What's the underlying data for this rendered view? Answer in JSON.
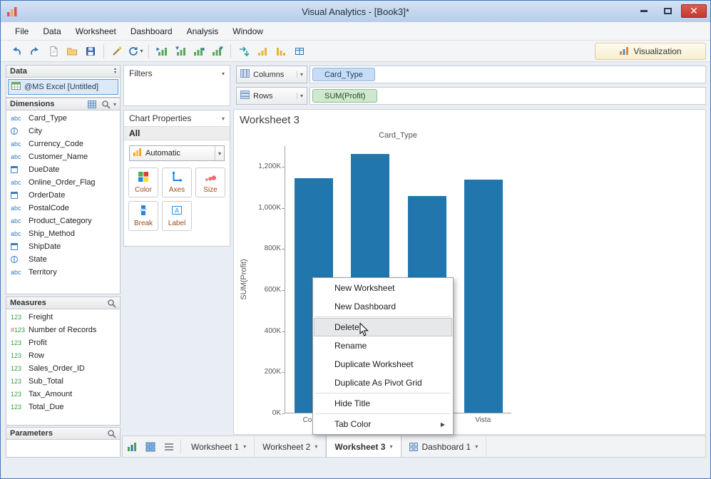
{
  "titlebar": {
    "title": "Visual Analytics - [Book3]*"
  },
  "menu": {
    "items": [
      "File",
      "Data",
      "Worksheet",
      "Dashboard",
      "Analysis",
      "Window"
    ]
  },
  "toolbar": {
    "visualization_label": "Visualization"
  },
  "data_panel": {
    "title": "Data",
    "datasource": "@MS Excel [Untitled]",
    "dimensions": {
      "title": "Dimensions",
      "items": [
        {
          "icon": "abc",
          "label": "Card_Type"
        },
        {
          "icon": "globe",
          "label": "City"
        },
        {
          "icon": "abc",
          "label": "Currency_Code"
        },
        {
          "icon": "abc",
          "label": "Customer_Name"
        },
        {
          "icon": "date",
          "label": "DueDate"
        },
        {
          "icon": "abc",
          "label": "Online_Order_Flag"
        },
        {
          "icon": "date",
          "label": "OrderDate"
        },
        {
          "icon": "abc",
          "label": "PostalCode"
        },
        {
          "icon": "abc",
          "label": "Product_Category"
        },
        {
          "icon": "abc",
          "label": "Ship_Method"
        },
        {
          "icon": "date",
          "label": "ShipDate"
        },
        {
          "icon": "globe",
          "label": "State"
        },
        {
          "icon": "abc",
          "label": "Territory"
        }
      ]
    },
    "measures": {
      "title": "Measures",
      "items": [
        {
          "icon": "123",
          "label": "Freight"
        },
        {
          "icon": "#123",
          "label": "Number of Records"
        },
        {
          "icon": "123",
          "label": "Profit"
        },
        {
          "icon": "123",
          "label": "Row"
        },
        {
          "icon": "123",
          "label": "Sales_Order_ID"
        },
        {
          "icon": "123",
          "label": "Sub_Total"
        },
        {
          "icon": "123",
          "label": "Tax_Amount"
        },
        {
          "icon": "123",
          "label": "Total_Due"
        }
      ]
    },
    "parameters": {
      "title": "Parameters"
    }
  },
  "filters_panel": {
    "title": "Filters"
  },
  "chart_properties": {
    "title": "Chart Properties",
    "scope": "All",
    "chart_type": "Automatic",
    "buttons": [
      "Color",
      "Axes",
      "Size",
      "Break",
      "Label"
    ]
  },
  "shelves": {
    "columns_label": "Columns",
    "columns_pill": "Card_Type",
    "rows_label": "Rows",
    "rows_pill": "SUM(Profit)"
  },
  "worksheet": {
    "title": "Worksheet 3"
  },
  "chart_data": {
    "type": "bar",
    "title": "Card_Type",
    "xlabel": "",
    "ylabel": "SUM(Profit)",
    "categories": [
      "Coloni",
      "",
      "",
      "Vista"
    ],
    "values": [
      1140000,
      1260000,
      1055000,
      1135000
    ],
    "ylim": [
      0,
      1300000
    ],
    "ytick_step": 200000,
    "ytick_labels": [
      "0K",
      "200K",
      "400K",
      "600K",
      "800K",
      "1,000K",
      "1,200K"
    ],
    "bar_color": "#2176ae",
    "grid": false,
    "legend": "none"
  },
  "context_menu": {
    "items": [
      {
        "label": "New Worksheet"
      },
      {
        "label": "New Dashboard",
        "sep_after": true
      },
      {
        "label": "Delete",
        "highlighted": true
      },
      {
        "label": "Rename"
      },
      {
        "label": "Duplicate Worksheet"
      },
      {
        "label": "Duplicate As Pivot Grid",
        "sep_after": true
      },
      {
        "label": "Hide Title",
        "sep_after": true
      },
      {
        "label": "Tab Color",
        "submenu": true
      }
    ]
  },
  "bottom_bar": {
    "tabs": [
      {
        "label": "Worksheet 1",
        "active": false,
        "icon": "worksheet"
      },
      {
        "label": "Worksheet 2",
        "active": false,
        "icon": "worksheet"
      },
      {
        "label": "Worksheet 3",
        "active": true,
        "icon": "worksheet"
      },
      {
        "label": "Dashboard 1",
        "active": false,
        "icon": "dashboard"
      }
    ]
  }
}
